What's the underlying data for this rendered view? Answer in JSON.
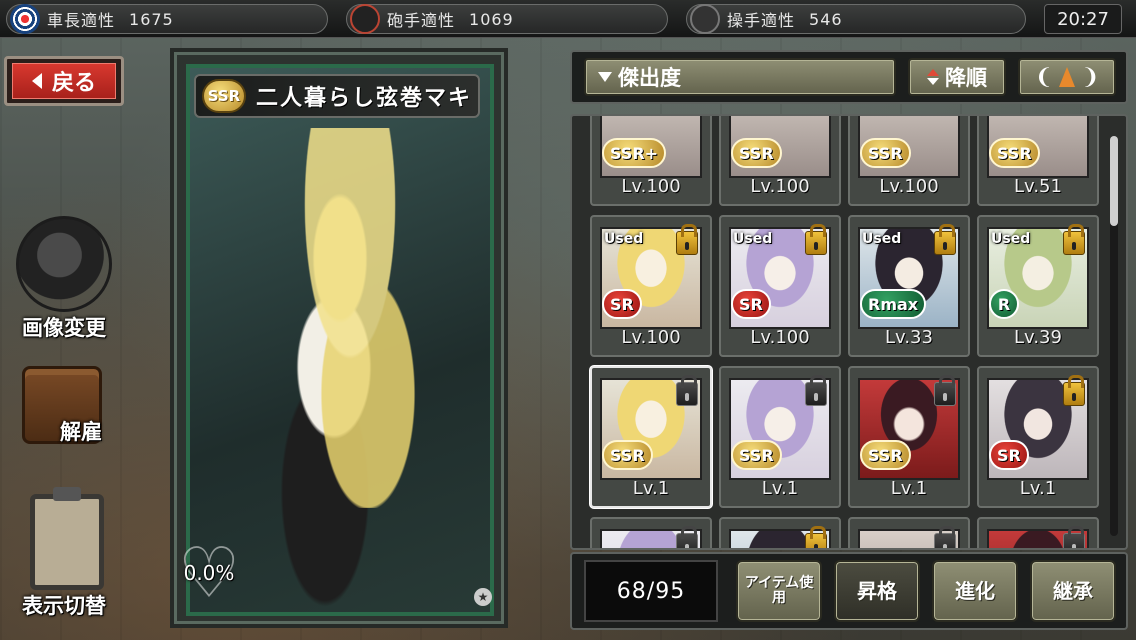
{
  "status": {
    "commander_label": "車長適性",
    "commander_value": "1675",
    "gunner_label": "砲手適性",
    "gunner_value": "1069",
    "driver_label": "操手適性",
    "driver_value": "546",
    "clock": "20:27"
  },
  "back_label": "戻る",
  "side_actions": {
    "change_image": "画像変更",
    "dismiss": "解雇",
    "toggle_display": "表示切替"
  },
  "card": {
    "rarity": "SSR",
    "name": "二人暮らし弦巻マキ",
    "affection": "0.0%"
  },
  "sort": {
    "filter_label": "傑出度",
    "order_label": "降順"
  },
  "units": [
    {
      "lv": "Lv.100",
      "rarity": "SSR+",
      "portrait": "generic",
      "used": false,
      "lock": "none"
    },
    {
      "lv": "Lv.100",
      "rarity": "SSR",
      "portrait": "generic",
      "used": false,
      "lock": "none"
    },
    {
      "lv": "Lv.100",
      "rarity": "SSR",
      "portrait": "generic",
      "used": false,
      "lock": "none"
    },
    {
      "lv": "Lv.51",
      "rarity": "SSR",
      "portrait": "generic",
      "used": false,
      "lock": "none"
    },
    {
      "lv": "Lv.100",
      "rarity": "SR",
      "portrait": "blonde",
      "used": true,
      "lock": "locked"
    },
    {
      "lv": "Lv.100",
      "rarity": "SR",
      "portrait": "purple",
      "used": true,
      "lock": "locked"
    },
    {
      "lv": "Lv.33",
      "rarity": "Rmax",
      "portrait": "dark",
      "used": true,
      "lock": "locked"
    },
    {
      "lv": "Lv.39",
      "rarity": "R",
      "portrait": "green",
      "used": true,
      "lock": "locked"
    },
    {
      "lv": "Lv.1",
      "rarity": "SSR",
      "portrait": "blonde",
      "used": false,
      "lock": "unlocked",
      "selected": true
    },
    {
      "lv": "Lv.1",
      "rarity": "SSR",
      "portrait": "purple",
      "used": false,
      "lock": "unlocked"
    },
    {
      "lv": "Lv.1",
      "rarity": "SSR",
      "portrait": "red",
      "used": false,
      "lock": "unlocked"
    },
    {
      "lv": "Lv.1",
      "rarity": "SR",
      "portrait": "darkgirl",
      "used": false,
      "lock": "locked"
    },
    {
      "lv": "",
      "rarity": "",
      "portrait": "purple",
      "used": false,
      "lock": "unlocked"
    },
    {
      "lv": "",
      "rarity": "",
      "portrait": "dark",
      "used": false,
      "lock": "locked"
    },
    {
      "lv": "",
      "rarity": "",
      "portrait": "generic",
      "used": false,
      "lock": "unlocked"
    },
    {
      "lv": "",
      "rarity": "",
      "portrait": "red",
      "used": false,
      "lock": "unlocked"
    }
  ],
  "bottom": {
    "count": "68/95",
    "item_use": "アイテム使用",
    "promote": "昇格",
    "evolve": "進化",
    "inherit": "継承"
  }
}
